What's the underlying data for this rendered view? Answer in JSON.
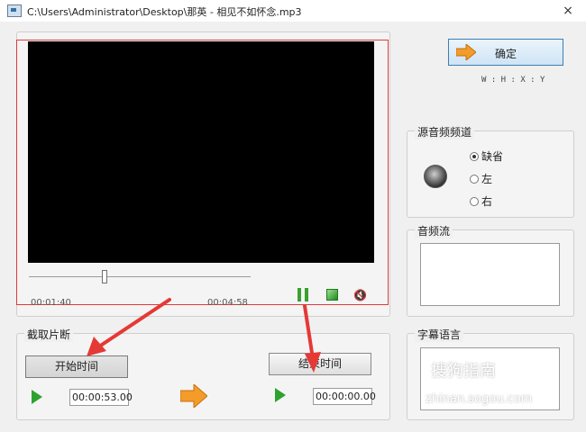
{
  "window": {
    "title": "C:\\Users\\Administrator\\Desktop\\那英 - 相见不如怀念.mp3",
    "close_glyph": "×"
  },
  "player": {
    "current_time": "00:01:40",
    "total_time": "00:04:58",
    "seek_position_fraction": 0.33
  },
  "confirm": {
    "label": "确定",
    "shortcut_hint": "W : H : X : Y"
  },
  "clip": {
    "group_label": "截取片断",
    "start_button": "开始时间",
    "end_button": "结束时间",
    "start_time": "00:00:53.00",
    "end_time": "00:00:00.00"
  },
  "audio_channel": {
    "group_label": "源音频频道",
    "options": [
      {
        "label": "缺省",
        "selected": true
      },
      {
        "label": "左",
        "selected": false
      },
      {
        "label": "右",
        "selected": false
      }
    ]
  },
  "audio_stream": {
    "group_label": "音频流"
  },
  "subtitle": {
    "group_label": "字幕语言"
  },
  "watermark": {
    "line1": "搜狗指南",
    "line2": "zhinan.sogou.com"
  },
  "colors": {
    "annotation_red": "#e53935",
    "play_green": "#2ea22e",
    "accent_orange": "#f39c2a"
  },
  "icons": [
    "app-icon",
    "close-icon",
    "pause-icon",
    "stop-icon",
    "mute-icon",
    "play-icon",
    "arrow-right-icon",
    "speaker-icon"
  ]
}
